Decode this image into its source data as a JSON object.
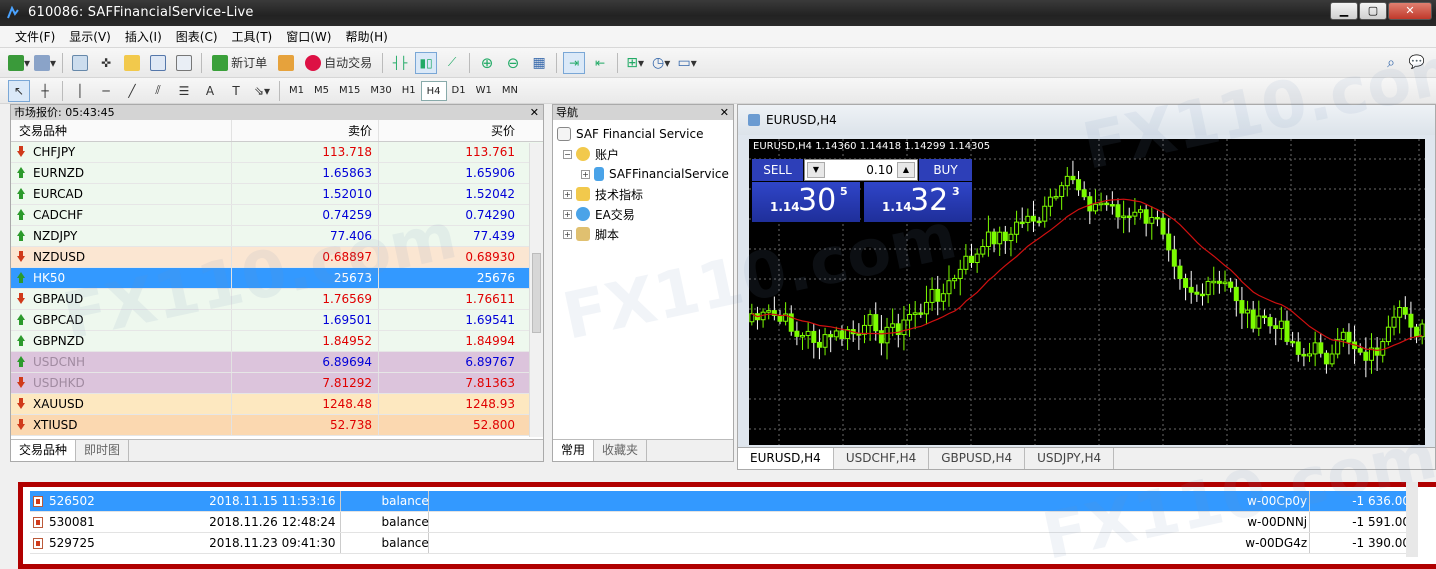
{
  "window": {
    "title": "610086: SAFFinancialService-Live"
  },
  "menu": [
    "文件(F)",
    "显示(V)",
    "插入(I)",
    "图表(C)",
    "工具(T)",
    "窗口(W)",
    "帮助(H)"
  ],
  "toolbar": {
    "new_order": "新订单",
    "auto_trade": "自动交易"
  },
  "timeframes": [
    "M1",
    "M5",
    "M15",
    "M30",
    "H1",
    "H4",
    "D1",
    "W1",
    "MN"
  ],
  "timeframe_selected": "H4",
  "market_watch": {
    "title": "市场报价: 05:43:45",
    "col_symbol": "交易品种",
    "col_bid": "卖价",
    "col_ask": "买价",
    "rows": [
      {
        "symbol": "CHFJPY",
        "bid": "113.718",
        "ask": "113.761",
        "dir": "down",
        "color": "red",
        "bg": "#eef8ee"
      },
      {
        "symbol": "EURNZD",
        "bid": "1.65863",
        "ask": "1.65906",
        "dir": "up",
        "color": "blue",
        "bg": "#eef8ee"
      },
      {
        "symbol": "EURCAD",
        "bid": "1.52010",
        "ask": "1.52042",
        "dir": "up",
        "color": "blue",
        "bg": "#eef8ee"
      },
      {
        "symbol": "CADCHF",
        "bid": "0.74259",
        "ask": "0.74290",
        "dir": "up",
        "color": "blue",
        "bg": "#eef8ee"
      },
      {
        "symbol": "NZDJPY",
        "bid": "77.406",
        "ask": "77.439",
        "dir": "up",
        "color": "blue",
        "bg": "#eef8ee"
      },
      {
        "symbol": "NZDUSD",
        "bid": "0.68897",
        "ask": "0.68930",
        "dir": "down",
        "color": "red",
        "bg": "#fbe6d2"
      },
      {
        "symbol": "HK50",
        "bid": "25673",
        "ask": "25676",
        "dir": "up",
        "color": "white",
        "bg": "#3399ff",
        "selected": true
      },
      {
        "symbol": "GBPAUD",
        "bid": "1.76569",
        "ask": "1.76611",
        "dir": "down",
        "color": "red",
        "bg": "#eef8ee"
      },
      {
        "symbol": "GBPCAD",
        "bid": "1.69501",
        "ask": "1.69541",
        "dir": "up",
        "color": "blue",
        "bg": "#eef8ee"
      },
      {
        "symbol": "GBPNZD",
        "bid": "1.84952",
        "ask": "1.84994",
        "dir": "up",
        "color": "red",
        "bg": "#eef8ee"
      },
      {
        "symbol": "USDCNH",
        "bid": "6.89694",
        "ask": "6.89767",
        "dir": "up",
        "color": "blue",
        "bg": "#dcc4dc",
        "dim": true
      },
      {
        "symbol": "USDHKD",
        "bid": "7.81292",
        "ask": "7.81363",
        "dir": "down",
        "color": "red",
        "bg": "#dcc4dc",
        "dim": true
      },
      {
        "symbol": "XAUUSD",
        "bid": "1248.48",
        "ask": "1248.93",
        "dir": "down",
        "color": "red",
        "bg": "#fde8c0"
      },
      {
        "symbol": "XTIUSD",
        "bid": "52.738",
        "ask": "52.800",
        "dir": "down",
        "color": "red",
        "bg": "#fbd8b0"
      }
    ],
    "tabs": [
      "交易品种",
      "即时图"
    ]
  },
  "navigator": {
    "title": "导航",
    "root": "SAF Financial Service",
    "items": [
      {
        "label": "账户",
        "level": 1,
        "toggle": "−"
      },
      {
        "label": "SAFFinancialService",
        "level": 2,
        "toggle": "+"
      },
      {
        "label": "技术指标",
        "level": 1,
        "toggle": "+"
      },
      {
        "label": "EA交易",
        "level": 1,
        "toggle": "+"
      },
      {
        "label": "脚本",
        "level": 1,
        "toggle": "+"
      }
    ],
    "tabs": [
      "常用",
      "收藏夹"
    ]
  },
  "chart": {
    "window_title": "EURUSD,H4",
    "header": "EURUSD,H4  1.14360 1.14418 1.14299 1.14305",
    "one_click": {
      "sell": "SELL",
      "buy": "BUY",
      "lot": "0.10",
      "sell_prefix": "1.14",
      "sell_big": "30",
      "sell_sup": "5",
      "buy_prefix": "1.14",
      "buy_big": "32",
      "buy_sup": "3"
    },
    "tabs": [
      "EURUSD,H4",
      "USDCHF,H4",
      "GBPUSD,H4",
      "USDJPY,H4"
    ]
  },
  "terminal": {
    "rows": [
      {
        "id": "526502",
        "time": "2018.11.15 11:53:16",
        "type": "balance",
        "comment": "w-00Cp0y",
        "amount": "-1 636.00",
        "selected": true
      },
      {
        "id": "530081",
        "time": "2018.11.26 12:48:24",
        "type": "balance",
        "comment": "w-00DNNj",
        "amount": "-1 591.00"
      },
      {
        "id": "529725",
        "time": "2018.11.23 09:41:30",
        "type": "balance",
        "comment": "w-00DG4z",
        "amount": "-1 390.00"
      }
    ]
  },
  "colors": {
    "sell_buy_panel": "#2d3fb8",
    "selection": "#3399ff",
    "bull_candle": "#7cfc00",
    "ma_line": "#d01010",
    "highlight_border": "#b00000"
  }
}
